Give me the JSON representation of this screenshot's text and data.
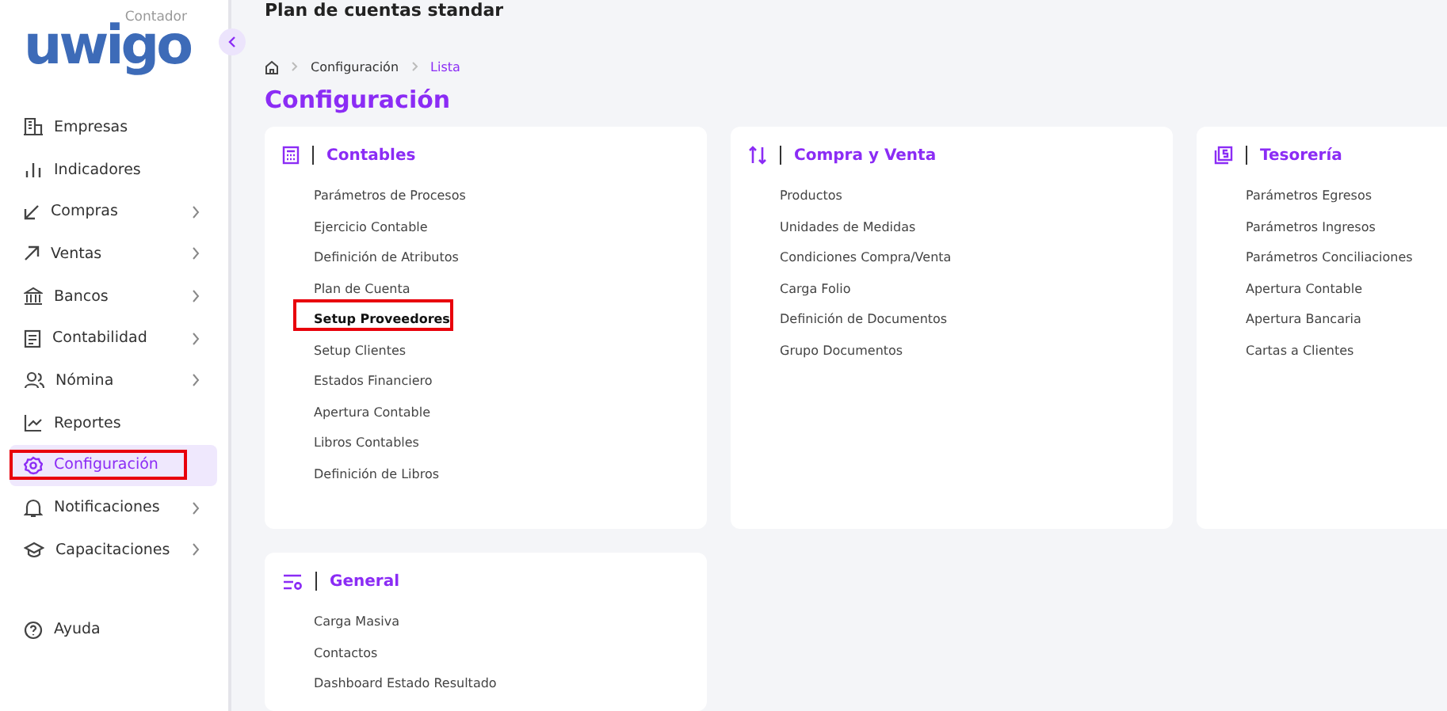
{
  "logo": {
    "name": "uwigo",
    "subtitle": "Contador"
  },
  "sidebar": {
    "items": [
      {
        "label": "Empresas",
        "selected": false,
        "expandable": false,
        "highlighted": false
      },
      {
        "label": "Indicadores",
        "selected": false,
        "expandable": false,
        "highlighted": false
      },
      {
        "label": "Compras",
        "selected": false,
        "expandable": true,
        "highlighted": false
      },
      {
        "label": "Ventas",
        "selected": false,
        "expandable": true,
        "highlighted": false
      },
      {
        "label": "Bancos",
        "selected": false,
        "expandable": true,
        "highlighted": false
      },
      {
        "label": "Contabilidad",
        "selected": false,
        "expandable": true,
        "highlighted": false
      },
      {
        "label": "Nómina",
        "selected": false,
        "expandable": true,
        "highlighted": false
      },
      {
        "label": "Reportes",
        "selected": false,
        "expandable": false,
        "highlighted": false
      },
      {
        "label": "Configuración",
        "selected": true,
        "expandable": false,
        "highlighted": true
      },
      {
        "label": "Notificaciones",
        "selected": false,
        "expandable": true,
        "highlighted": false
      },
      {
        "label": "Capacitaciones",
        "selected": false,
        "expandable": true,
        "highlighted": false
      }
    ],
    "footer": {
      "label": "Ayuda"
    }
  },
  "page_header": {
    "title": "Plan de cuentas standar"
  },
  "breadcrumb": [
    {
      "label": "Configuración",
      "selected": false
    },
    {
      "label": "Lista",
      "selected": true
    }
  ],
  "heading": "Configuración",
  "cards": [
    {
      "title": "Contables",
      "items": [
        {
          "label": "Parámetros de Procesos",
          "highlighted": false
        },
        {
          "label": "Ejercicio Contable",
          "highlighted": false
        },
        {
          "label": "Definición de Atributos",
          "highlighted": false
        },
        {
          "label": "Plan de Cuenta",
          "highlighted": false
        },
        {
          "label": "Setup Proveedores",
          "highlighted": true
        },
        {
          "label": "Setup Clientes",
          "highlighted": false
        },
        {
          "label": "Estados Financiero",
          "highlighted": false
        },
        {
          "label": "Apertura Contable",
          "highlighted": false
        },
        {
          "label": "Libros Contables",
          "highlighted": false
        },
        {
          "label": "Definición de Libros",
          "highlighted": false
        }
      ]
    },
    {
      "title": "Compra y Venta",
      "items": [
        {
          "label": "Productos",
          "highlighted": false
        },
        {
          "label": "Unidades de Medidas",
          "highlighted": false
        },
        {
          "label": "Condiciones Compra/Venta",
          "highlighted": false
        },
        {
          "label": "Carga Folio",
          "highlighted": false
        },
        {
          "label": "Definición de Documentos",
          "highlighted": false
        },
        {
          "label": "Grupo Documentos",
          "highlighted": false
        }
      ]
    },
    {
      "title": "Tesorería",
      "items": [
        {
          "label": "Parámetros Egresos",
          "highlighted": false
        },
        {
          "label": "Parámetros Ingresos",
          "highlighted": false
        },
        {
          "label": "Parámetros Conciliaciones",
          "highlighted": false
        },
        {
          "label": "Apertura Contable",
          "highlighted": false
        },
        {
          "label": "Apertura Bancaria",
          "highlighted": false
        },
        {
          "label": "Cartas a Clientes",
          "highlighted": false
        }
      ]
    },
    {
      "title": "General",
      "items": [
        {
          "label": "Carga Masiva",
          "highlighted": false
        },
        {
          "label": "Contactos",
          "highlighted": false
        },
        {
          "label": "Dashboard Estado Resultado",
          "highlighted": false
        }
      ]
    }
  ]
}
